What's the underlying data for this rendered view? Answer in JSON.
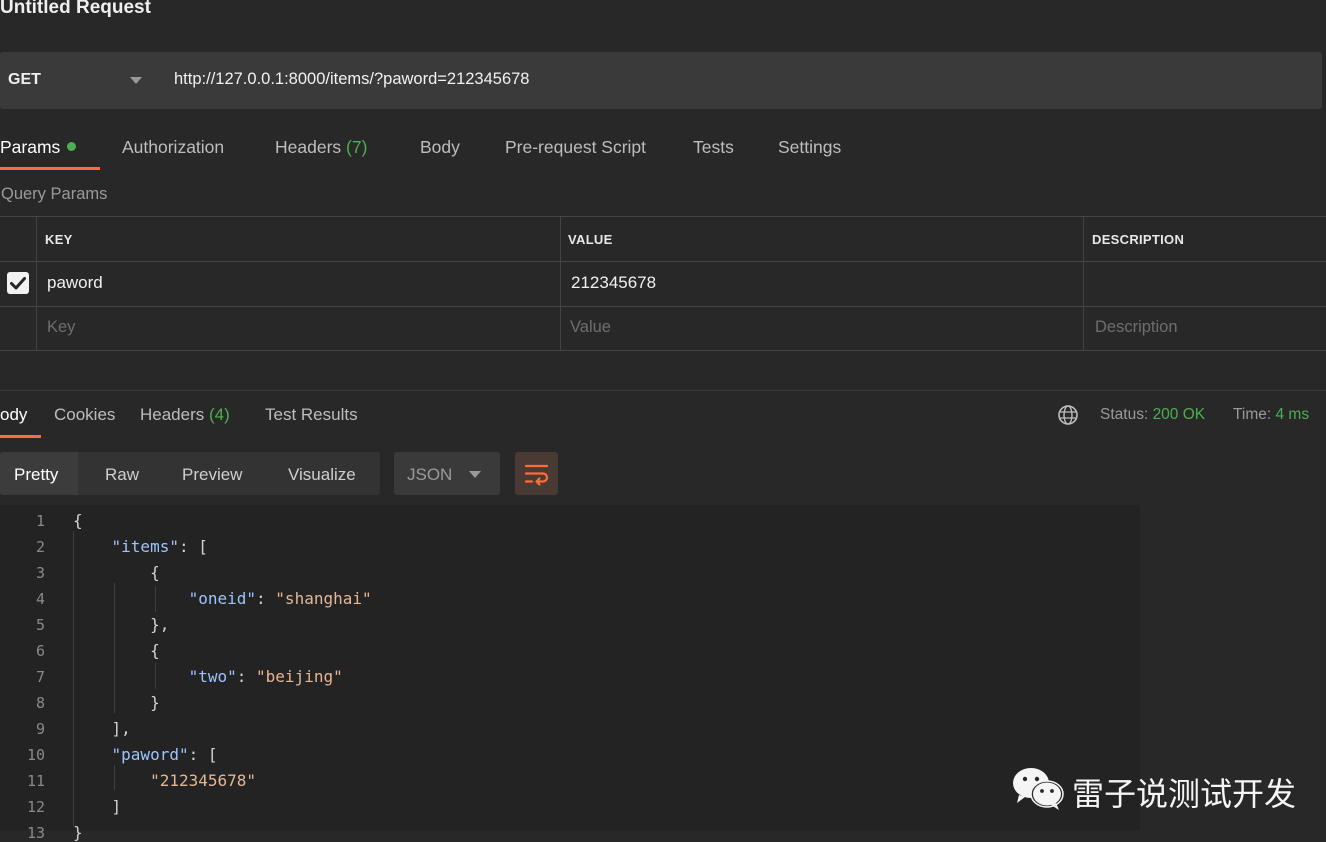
{
  "request": {
    "title": "Untitled Request",
    "method": "GET",
    "url": "http://127.0.0.1:8000/items/?paword=212345678"
  },
  "request_tabs": {
    "params": "Params",
    "authorization": "Authorization",
    "headers": "Headers",
    "headers_count": "(7)",
    "body": "Body",
    "prerequest": "Pre-request Script",
    "tests": "Tests",
    "settings": "Settings"
  },
  "query_params": {
    "label": "Query Params",
    "columns": {
      "key": "KEY",
      "value": "VALUE",
      "description": "DESCRIPTION"
    },
    "rows": [
      {
        "checked": true,
        "key": "paword",
        "value": "212345678",
        "description": ""
      }
    ],
    "placeholders": {
      "key": "Key",
      "value": "Value",
      "description": "Description"
    }
  },
  "response_tabs": {
    "body": "ody",
    "cookies": "Cookies",
    "headers": "Headers",
    "headers_count": "(4)",
    "test_results": "Test Results"
  },
  "status": {
    "status_label": "Status:",
    "status_value": "200 OK",
    "time_label": "Time:",
    "time_value": "4 ms"
  },
  "view_modes": {
    "pretty": "Pretty",
    "raw": "Raw",
    "preview": "Preview",
    "visualize": "Visualize",
    "format": "JSON"
  },
  "code": {
    "line_numbers": [
      "1",
      "2",
      "3",
      "4",
      "5",
      "6",
      "7",
      "8",
      "9",
      "10",
      "11",
      "12",
      "13"
    ],
    "lines": [
      {
        "p1": "{"
      },
      {
        "p1": "    ",
        "k": "\"items\"",
        "p2": ": ["
      },
      {
        "p1": "        {"
      },
      {
        "p1": "            ",
        "k": "\"oneid\"",
        "p2": ": ",
        "s": "\"shanghai\""
      },
      {
        "p1": "        },"
      },
      {
        "p1": "        {"
      },
      {
        "p1": "            ",
        "k": "\"two\"",
        "p2": ": ",
        "s": "\"beijing\""
      },
      {
        "p1": "        }"
      },
      {
        "p1": "    ],"
      },
      {
        "p1": "    ",
        "k": "\"paword\"",
        "p2": ": ["
      },
      {
        "p1": "        ",
        "s": "\"212345678\""
      },
      {
        "p1": "    ]"
      },
      {
        "p1": "}"
      }
    ]
  },
  "watermark": {
    "text": "雷子说测试开发"
  },
  "colors": {
    "accent": "#ff6c37",
    "success": "#4caf50",
    "json_key": "#9cc4ff",
    "json_string": "#e5b694"
  }
}
